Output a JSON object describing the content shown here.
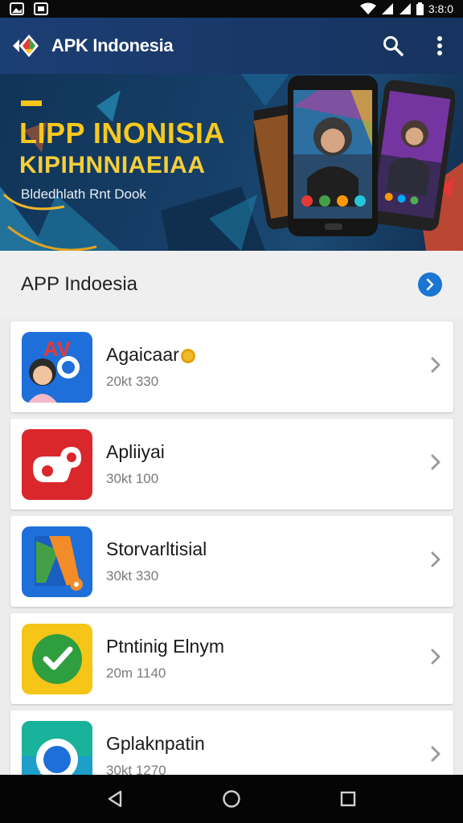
{
  "status_bar": {
    "time": "3:8:0",
    "icons": [
      "gallery-icon",
      "image-icon",
      "wifi-icon",
      "signal-icon",
      "signal-icon",
      "battery-icon"
    ]
  },
  "app_bar": {
    "title": "APK Indonesia",
    "actions": [
      "search-icon",
      "more-vert-icon"
    ]
  },
  "banner": {
    "headline_1": "LIPP INONISIA",
    "headline_2": "KIPIHNNIAEIAA",
    "subtitle": "Bldedhlath Rnt Dook"
  },
  "section": {
    "title": "APP Indoesia"
  },
  "apps": [
    {
      "name": "Agaicaar",
      "meta": "20kt 330"
    },
    {
      "name": "Apliiyai",
      "meta": "30kt 100"
    },
    {
      "name": "Storvarltisial",
      "meta": "30kt 330"
    },
    {
      "name": "Ptntinig Elnym",
      "meta": "20m 1140"
    },
    {
      "name": "Gplaknpatin",
      "meta": "30kt 1270"
    }
  ],
  "nav_bar": {
    "buttons": [
      "back-icon",
      "home-icon",
      "recents-icon"
    ]
  },
  "colors": {
    "app_bar": "#1b3e74",
    "accent": "#1976d2",
    "banner_text": "#f7c81e"
  }
}
